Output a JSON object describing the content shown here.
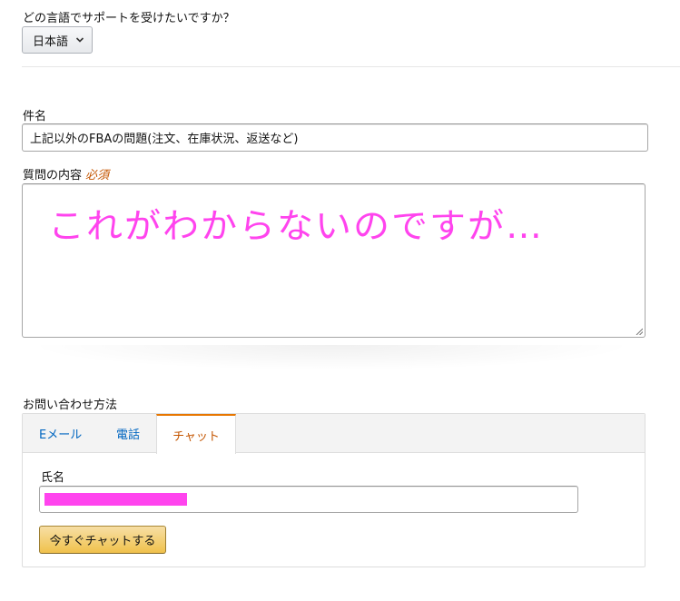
{
  "language": {
    "question": "どの言語でサポートを受けたいですか？",
    "selected": "日本語"
  },
  "subject": {
    "label": "件名",
    "value": "上記以外のFBAの問題(注文、在庫状況、返送など)"
  },
  "question_field": {
    "label": "質問の内容",
    "required": "必須",
    "value": "これがわからないのですが…"
  },
  "contact": {
    "label": "お問い合わせ方法",
    "tabs": [
      {
        "label": "Eメール"
      },
      {
        "label": "電話"
      },
      {
        "label": "チャット"
      }
    ],
    "active_tab": "チャット",
    "name_label": "氏名",
    "chat_button": "今すぐチャットする"
  },
  "colors": {
    "annotation_magenta": "#ff44ee",
    "link_blue": "#0066c0",
    "active_tab_orange": "#c45500",
    "button_gold": "#f0c14b"
  }
}
